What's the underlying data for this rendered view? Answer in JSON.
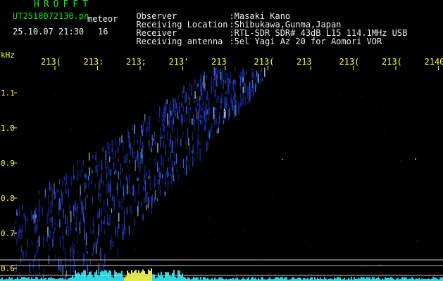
{
  "header": {
    "app_title": "HROFFT",
    "file_name": "UT2510072130.pn",
    "mode": "meteor",
    "datetime": "25.10.07 21:30",
    "count": "16"
  },
  "station": [
    {
      "key": "Observer",
      "value": ":Masaki Kano"
    },
    {
      "key": "Receiving Location",
      "value": ":Shibukawa,Gunma,Japan"
    },
    {
      "key": "Receiver",
      "value": ":RTL-SDR SDR# 43dB L15 114.1MHz USB"
    },
    {
      "key": "Receiving antenna",
      "value": ":5el Yagi Az 20 for Aomori VOR"
    }
  ],
  "axes": {
    "y_unit": "kHz",
    "y_ticks": [
      "1.1",
      "1.0",
      "0.9",
      "0.8",
      "0.7",
      "0.6"
    ],
    "x_ticks": [
      "213(",
      "213:",
      "213;",
      "213‘",
      "213",
      "213(",
      "213",
      "213(",
      "213(",
      "2140"
    ]
  },
  "colors": {
    "background": "#000000",
    "header_text": "#19e619",
    "label_text": "#f0f0f0",
    "tick_text": "#ffff33",
    "signal": "#3a6cff",
    "spectrum": "#29d9e6"
  }
}
